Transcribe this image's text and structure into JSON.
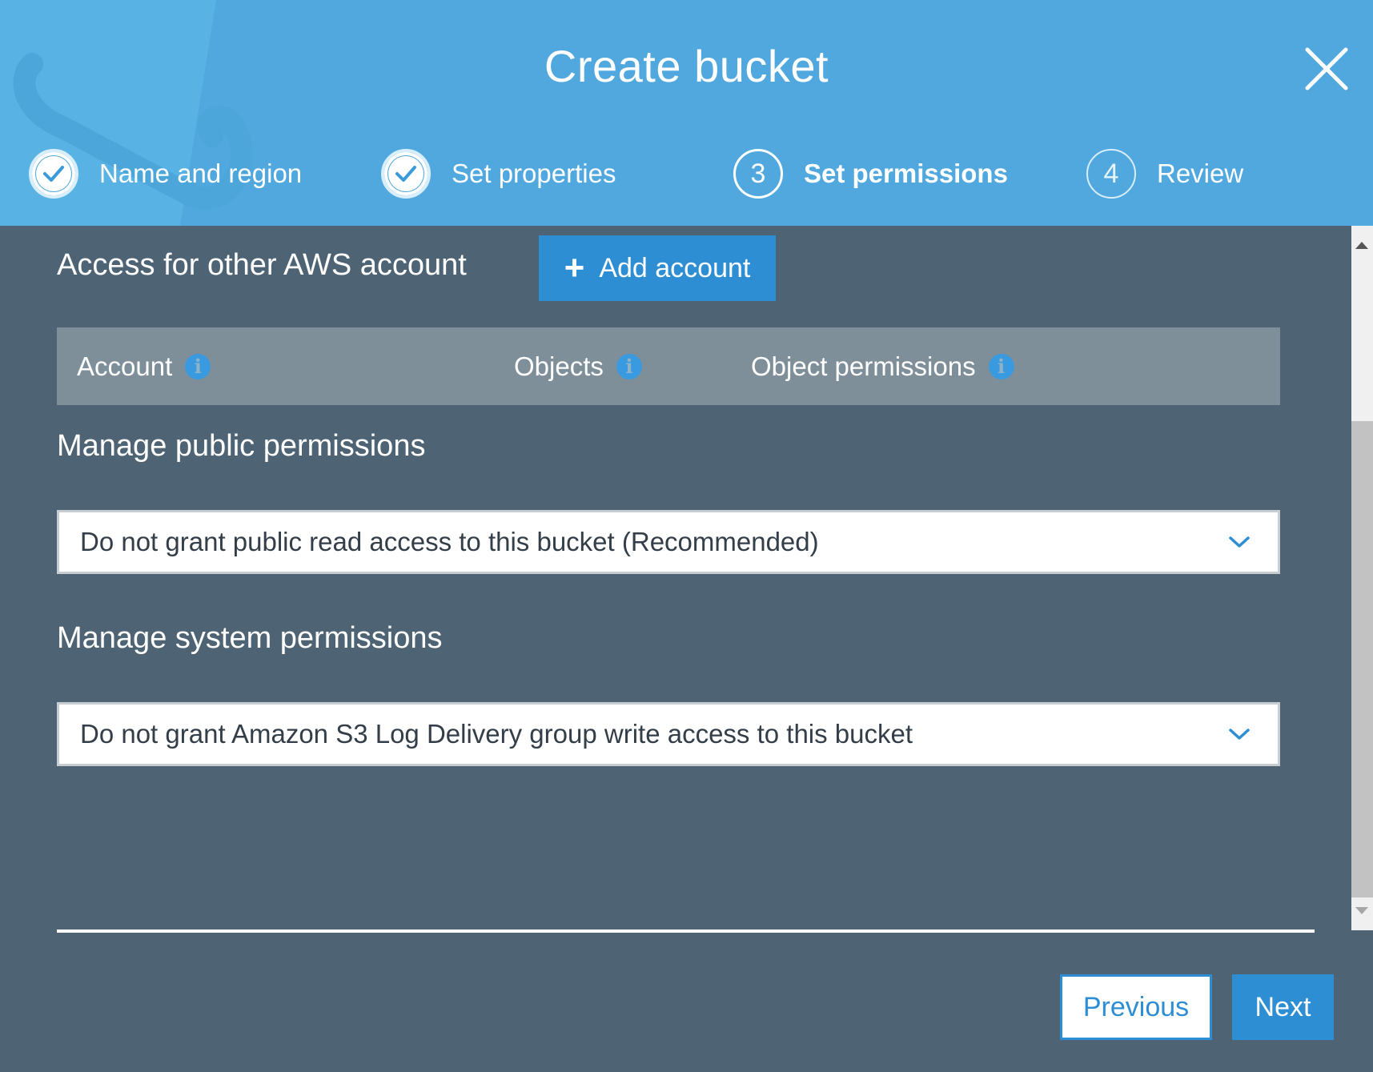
{
  "dialog": {
    "title": "Create bucket"
  },
  "steps": [
    {
      "number": "",
      "label": "Name and region",
      "status": "complete"
    },
    {
      "number": "",
      "label": "Set properties",
      "status": "complete"
    },
    {
      "number": "3",
      "label": "Set permissions",
      "status": "active"
    },
    {
      "number": "4",
      "label": "Review",
      "status": "pending"
    }
  ],
  "other_accounts": {
    "title": "Access for other AWS account",
    "add_button_label": "Add account",
    "columns": [
      "Account",
      "Objects",
      "Object permissions"
    ]
  },
  "public_permissions": {
    "title": "Manage public permissions",
    "selected": "Do not grant public read access to this bucket (Recommended)"
  },
  "system_permissions": {
    "title": "Manage system permissions",
    "selected": "Do not grant Amazon S3 Log Delivery group write access to this bucket"
  },
  "footer": {
    "previous_label": "Previous",
    "next_label": "Next"
  },
  "colors": {
    "header_bg": "#50a8de",
    "body_bg": "#4e6474",
    "primary_button": "#2e8ed3",
    "table_header_bg": "#7e8f9a"
  },
  "icons": {
    "close": "close-icon",
    "check": "checkmark-icon",
    "info": "info-icon",
    "plus": "plus-icon",
    "dropdown": "chevron-down-icon"
  }
}
